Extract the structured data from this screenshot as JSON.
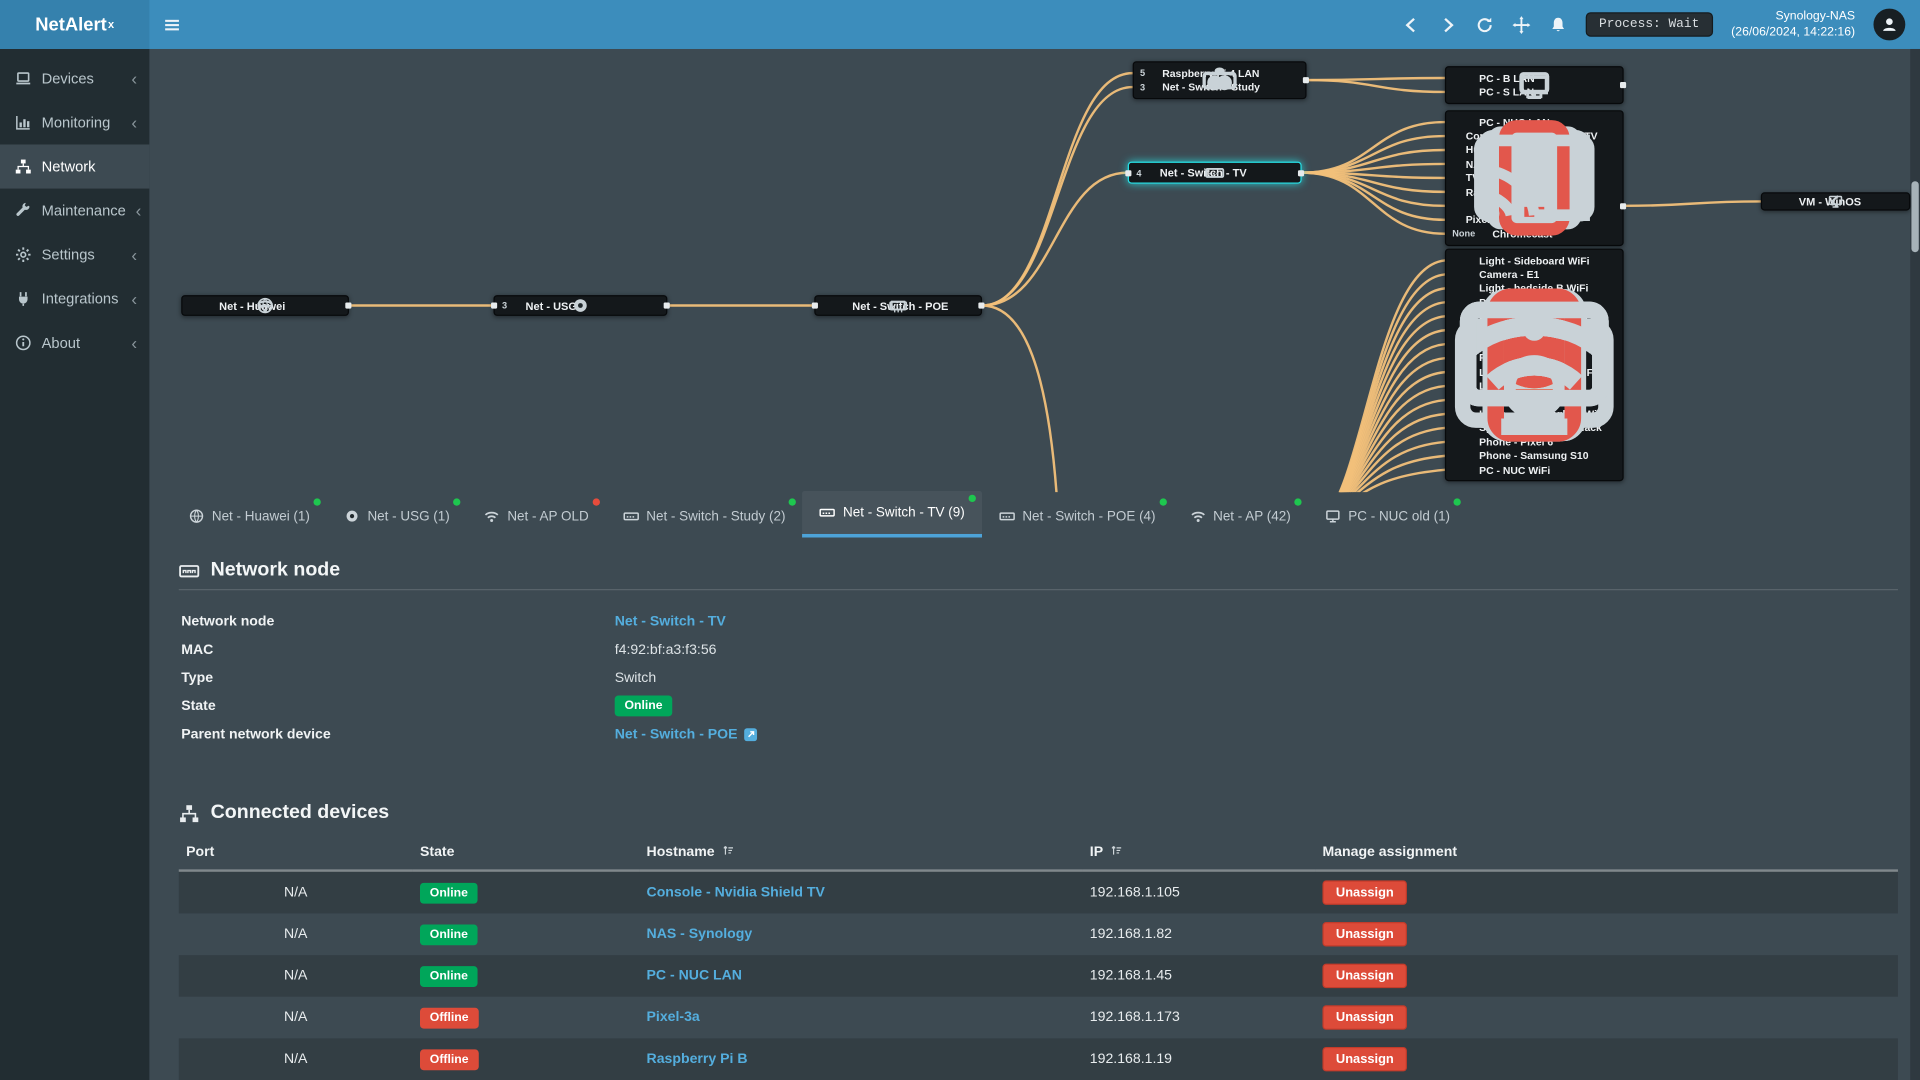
{
  "app": {
    "logo_text": "NetAlert",
    "logo_sup": "x"
  },
  "colors": {
    "accent": "#3c8dbc",
    "green_badge": "#00a65a",
    "red_badge": "#dd4b39",
    "green_dot": "#1ec74f",
    "red_dot": "#e74c3c",
    "link": "#54aede",
    "line": "#f2c07a",
    "highlight": "#27e0e6"
  },
  "topbar": {
    "process_badge": "Process: Wait",
    "host": "Synology-NAS",
    "timestamp": "(26/06/2024, 14:22:16)"
  },
  "sidebar": {
    "items": [
      {
        "label": "Devices",
        "icon": "laptop",
        "expandable": true
      },
      {
        "label": "Monitoring",
        "icon": "chart",
        "expandable": true
      },
      {
        "label": "Network",
        "icon": "sitemap",
        "active": true
      },
      {
        "label": "Maintenance",
        "icon": "wrench",
        "expandable": true
      },
      {
        "label": "Settings",
        "icon": "gear",
        "expandable": true
      },
      {
        "label": "Integrations",
        "icon": "plug",
        "expandable": true
      },
      {
        "label": "About",
        "icon": "info",
        "expandable": true
      }
    ]
  },
  "diagram": {
    "nodes": [
      {
        "id": "huawei",
        "rows": [
          {
            "icons": [
              {
                "n": "wifi"
              },
              {
                "n": "globe"
              }
            ],
            "label": "Net - Huawei"
          }
        ],
        "conn": [
          "r"
        ]
      },
      {
        "id": "usg",
        "rows": [
          {
            "num": "3",
            "icons": [
              {
                "n": "usg"
              }
            ],
            "label": "Net - USG"
          }
        ],
        "conn": [
          "l",
          "r"
        ]
      },
      {
        "id": "poe",
        "rows": [
          {
            "icons": [
              {
                "n": "eth"
              },
              {
                "n": "switch"
              }
            ],
            "label": "Net - Switch - POE"
          }
        ],
        "conn": [
          "l",
          "r"
        ]
      },
      {
        "id": "topgroup",
        "rows": [
          {
            "num": "5",
            "icons": [
              {
                "n": "raspberry"
              }
            ],
            "label": "Raspberry Pi 4 LAN"
          },
          {
            "num": "3",
            "icons": [
              {
                "n": "switch"
              }
            ],
            "label": "Net - Switch - Study"
          }
        ],
        "conn": [
          "r"
        ]
      },
      {
        "id": "tv",
        "highlight": true,
        "rows": [
          {
            "num": "4",
            "icons": [
              {
                "n": "switch"
              }
            ],
            "label": "Net - Switch - TV"
          }
        ],
        "conn": [
          "l",
          "r"
        ]
      },
      {
        "id": "lanTop",
        "rows": [
          {
            "icons": [
              {
                "n": "eth"
              },
              {
                "n": "pc"
              }
            ],
            "label": "PC - B LAN"
          },
          {
            "icons": [
              {
                "n": "eth"
              },
              {
                "n": "pc"
              }
            ],
            "label": "PC - S LAN"
          }
        ],
        "conn": [
          "r"
        ]
      },
      {
        "id": "tvBox",
        "rows": [
          {
            "icons": [
              {
                "n": "eth"
              },
              {
                "n": "pc"
              }
            ],
            "label": "PC - NUC LAN"
          },
          {
            "icons": [
              {
                "n": "gamepad"
              }
            ],
            "label": "Console - Nvidia Shield TV"
          },
          {
            "icons": [
              {
                "n": "hub"
              }
            ],
            "label": "Hub - Cygnet Hub"
          },
          {
            "icons": [
              {
                "n": "server"
              }
            ],
            "label": "NAS - Synology"
          },
          {
            "icons": [
              {
                "n": "tv"
              }
            ],
            "label": "TV - Frame LAN"
          },
          {
            "icons": [
              {
                "n": "raspberry"
              }
            ],
            "label": "Raspberry Pi B"
          },
          {
            "icons": [
              {
                "n": "eth"
              },
              {
                "n": "pc"
              }
            ],
            "label": "PC - NUC old"
          },
          {
            "icons": [
              {
                "n": "phone",
                "c": "#e2574c"
              }
            ],
            "label": "Pixel-3a"
          },
          {
            "num": "None",
            "icons": [
              {
                "n": "cast"
              }
            ],
            "label": "Chromecast"
          }
        ]
      },
      {
        "id": "winos",
        "rows": [
          {
            "icons": [
              {
                "n": "arrow-left"
              },
              {
                "n": "pc"
              }
            ],
            "label": "VM - WinOS"
          }
        ]
      },
      {
        "id": "wifiBox",
        "rows": [
          {
            "icons": [
              {
                "n": "wifi"
              },
              {
                "n": "bulb",
                "c": "#e9c84f"
              }
            ],
            "label": "Light - Sideboard WiFi"
          },
          {
            "icons": [
              {
                "n": "wifi"
              },
              {
                "n": "camera"
              }
            ],
            "label": "Camera - E1"
          },
          {
            "icons": [
              {
                "n": "wifi"
              },
              {
                "n": "bulb",
                "c": "#e2574c"
              }
            ],
            "label": "Light - bedside B WiFi"
          },
          {
            "icons": [
              {
                "n": "wifi"
              },
              {
                "n": "pc"
              }
            ],
            "label": "PC - S WiFi"
          },
          {
            "icons": [
              {
                "n": "wifi"
              },
              {
                "n": "bulb",
                "c": "#e2574c"
              }
            ],
            "label": "Light - bedside S WiFi"
          },
          {
            "icons": [
              {
                "n": "wifi"
              },
              {
                "n": "plug"
              }
            ],
            "label": "Plug - Washroom"
          },
          {
            "icons": [
              {
                "n": "wifi"
              },
              {
                "n": "speaker"
              }
            ],
            "label": "Speaker - Google Display"
          },
          {
            "icons": [
              {
                "n": "wifi"
              },
              {
                "n": "pc"
              }
            ],
            "label": "PC - B WiFi"
          },
          {
            "icons": [
              {
                "n": "wifi"
              },
              {
                "n": "bulb",
                "c": "#e9c84f"
              }
            ],
            "label": "Light - Dining light WiFi"
          },
          {
            "icons": [
              {
                "n": "wifi"
              },
              {
                "n": "bulb",
                "c": "#e9c84f"
              }
            ],
            "label": "Light - Study WiFi"
          },
          {
            "icons": [
              {
                "n": "wifi"
              },
              {
                "n": "bulb",
                "c": "#e2574c"
              }
            ],
            "label": "Light - ceiling-light-1 WiFi"
          },
          {
            "icons": [
              {
                "n": "wifi"
              },
              {
                "n": "bulb",
                "c": "#e2574c"
              }
            ],
            "label": "Light - ceiling-light-2 WiFi"
          },
          {
            "icons": [
              {
                "n": "wifi"
              },
              {
                "n": "speaker"
              }
            ],
            "label": "Speaker - Google - Black"
          },
          {
            "icons": [
              {
                "n": "wifi"
              },
              {
                "n": "phone"
              }
            ],
            "label": "Phone - Pixel 6"
          },
          {
            "icons": [
              {
                "n": "wifi"
              },
              {
                "n": "phone",
                "c": "#e2574c"
              }
            ],
            "label": "Phone - Samsung S10"
          },
          {
            "icons": [
              {
                "n": "wifi"
              },
              {
                "n": "pc"
              }
            ],
            "label": "PC - NUC WiFi"
          }
        ]
      }
    ]
  },
  "tabs": [
    {
      "label": "Net - Huawei (1)",
      "icon": "globe",
      "dot": "green"
    },
    {
      "label": "Net - USG (1)",
      "icon": "usg",
      "dot": "green"
    },
    {
      "label": "Net - AP OLD",
      "icon": "wifi",
      "dot": "red"
    },
    {
      "label": "Net - Switch - Study (2)",
      "icon": "switch",
      "dot": "green"
    },
    {
      "label": "Net - Switch - TV (9)",
      "icon": "switch",
      "dot": "green",
      "active": true
    },
    {
      "label": "Net - Switch - POE (4)",
      "icon": "switch",
      "dot": "green"
    },
    {
      "label": "Net - AP (42)",
      "icon": "wifi",
      "dot": "green"
    },
    {
      "label": "PC - NUC old (1)",
      "icon": "pc",
      "dot": "green"
    }
  ],
  "node_panel": {
    "title": "Network node",
    "rows": [
      {
        "label": "Network node",
        "value": "Net - Switch - TV",
        "type": "link"
      },
      {
        "label": "MAC",
        "value": "f4:92:bf:a3:f3:56",
        "type": "text"
      },
      {
        "label": "Type",
        "value": "Switch",
        "type": "text"
      },
      {
        "label": "State",
        "value": "Online",
        "type": "badge-green"
      },
      {
        "label": "Parent network device",
        "value": "Net - Switch - POE",
        "type": "link-ext"
      }
    ]
  },
  "devices_panel": {
    "title": "Connected devices",
    "columns": [
      "Port",
      "State",
      "Hostname",
      "IP",
      "Manage assignment"
    ],
    "sortable": [
      "Hostname",
      "IP"
    ],
    "unassign_label": "Unassign",
    "rows": [
      {
        "port": "N/A",
        "state": "Online",
        "hostname": "Console - Nvidia Shield TV",
        "ip": "192.168.1.105"
      },
      {
        "port": "N/A",
        "state": "Online",
        "hostname": "NAS - Synology",
        "ip": "192.168.1.82"
      },
      {
        "port": "N/A",
        "state": "Online",
        "hostname": "PC - NUC LAN",
        "ip": "192.168.1.45"
      },
      {
        "port": "N/A",
        "state": "Offline",
        "hostname": "Pixel-3a",
        "ip": "192.168.1.173"
      },
      {
        "port": "N/A",
        "state": "Offline",
        "hostname": "Raspberry Pi B",
        "ip": "192.168.1.19"
      }
    ]
  }
}
